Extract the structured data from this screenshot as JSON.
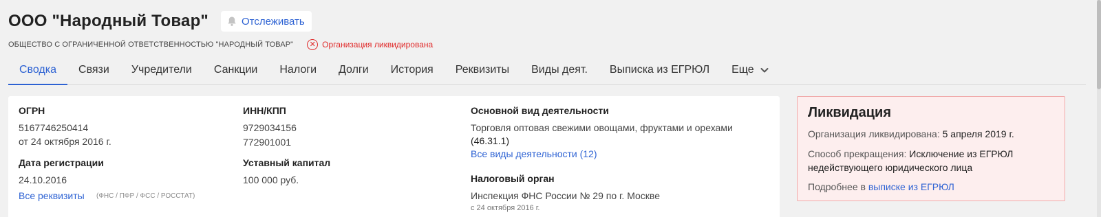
{
  "header": {
    "title": "ООО \"Народный Товар\"",
    "track_label": "Отслеживать",
    "full_name": "ОБЩЕСТВО С ОГРАНИЧЕННОЙ ОТВЕТСТВЕННОСТЬЮ \"НАРОДНЫЙ ТОВАР\"",
    "status_text": "Организация ликвидирована"
  },
  "tabs": [
    {
      "label": "Сводка",
      "active": true
    },
    {
      "label": "Связи"
    },
    {
      "label": "Учредители"
    },
    {
      "label": "Санкции"
    },
    {
      "label": "Налоги"
    },
    {
      "label": "Долги"
    },
    {
      "label": "История"
    },
    {
      "label": "Реквизиты"
    },
    {
      "label": "Виды деят."
    },
    {
      "label": "Выписка из ЕГРЮЛ"
    },
    {
      "label": "Еще"
    }
  ],
  "summary": {
    "ogrn_label": "ОГРН",
    "ogrn_value": "5167746250414",
    "ogrn_date": "от 24 октября 2016 г.",
    "reg_date_label": "Дата регистрации",
    "reg_date_value": "24.10.2016",
    "all_requisites_link": "Все реквизиты",
    "requisites_sources": "(ФНС / ПФР / ФСС / РОССТАТ)",
    "inn_kpp_label": "ИНН/КПП",
    "inn_value": "9729034156",
    "kpp_value": "772901001",
    "capital_label": "Уставный капитал",
    "capital_value": "100 000 руб.",
    "main_activity_label": "Основной вид деятельности",
    "main_activity_value": "Торговля оптовая свежими овощами, фруктами и орехами",
    "main_activity_code": "(46.31.1)",
    "all_activities_link": "Все виды деятельности (12)",
    "tax_authority_label": "Налоговый орган",
    "tax_authority_value": "Инспекция ФНС России № 29 по г. Москве",
    "tax_authority_date": "с 24 октября 2016 г."
  },
  "liquidation": {
    "title": "Ликвидация",
    "liquidated_label": "Организация ликвидирована:",
    "liquidated_date": "5 апреля 2019 г.",
    "method_label": "Способ прекращения:",
    "method_value": "Исключение из ЕГРЮЛ недействующего юридического лица",
    "more_prefix": "Подробнее в",
    "more_link": "выписке из ЕГРЮЛ"
  },
  "colors": {
    "accent": "#2d62d3",
    "danger": "#e02828",
    "liquidation_bg": "#fdeeee",
    "liquidation_border": "#f0a9a9",
    "page_bg": "#f1f1f1"
  },
  "icons": {
    "track": "bell-icon",
    "status": "x-circle-icon",
    "more": "chevron-down-icon"
  }
}
